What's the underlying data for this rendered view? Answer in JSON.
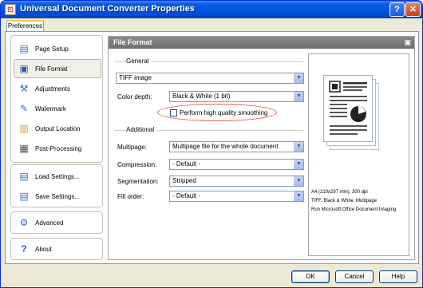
{
  "window": {
    "title": "Universal Document Converter Properties"
  },
  "tabs": [
    {
      "label": "Preferences"
    }
  ],
  "sidebar": {
    "group1": [
      {
        "label": "Page Setup",
        "icon": "page-setup-icon"
      },
      {
        "label": "File Format",
        "icon": "file-format-icon",
        "selected": true
      },
      {
        "label": "Adjustments",
        "icon": "adjustments-icon"
      },
      {
        "label": "Watermark",
        "icon": "watermark-icon"
      },
      {
        "label": "Output Location",
        "icon": "output-location-icon"
      },
      {
        "label": "Post-Processing",
        "icon": "post-processing-icon"
      }
    ],
    "group2": [
      {
        "label": "Load Settings...",
        "icon": "load-settings-icon"
      },
      {
        "label": "Save Settings...",
        "icon": "save-settings-icon"
      }
    ],
    "group3": [
      {
        "label": "Advanced",
        "icon": "advanced-icon"
      }
    ],
    "group4": [
      {
        "label": "About",
        "icon": "about-icon"
      }
    ]
  },
  "content": {
    "title": "File Format",
    "general": {
      "label": "General",
      "format_value": "TIFF image",
      "color_depth_label": "Color depth:",
      "color_depth_value": "Black & White (1 bit)",
      "smoothing_label": "Perform high quality smoothing",
      "smoothing_checked": false
    },
    "additional": {
      "label": "Additional",
      "multipage_label": "Multipage:",
      "multipage_value": "Multipage file for the whole document",
      "compression_label": "Compression:",
      "compression_value": "- Default -",
      "segmentation_label": "Segmentation:",
      "segmentation_value": "Stripped",
      "fill_order_label": "Fill order:",
      "fill_order_value": "- Default -"
    }
  },
  "preview": {
    "line1": "A4 (210x297 mm), 300 dpi",
    "line2": "TIFF, Black & White, Multipage",
    "line3": "Run Microsoft Office Document Imaging"
  },
  "buttons": {
    "ok": "OK",
    "cancel": "Cancel",
    "help": "Help"
  },
  "colors": {
    "titlebar": "#0054e3",
    "highlight": "#e05a4a",
    "panel_header": "#7a7a7a"
  }
}
